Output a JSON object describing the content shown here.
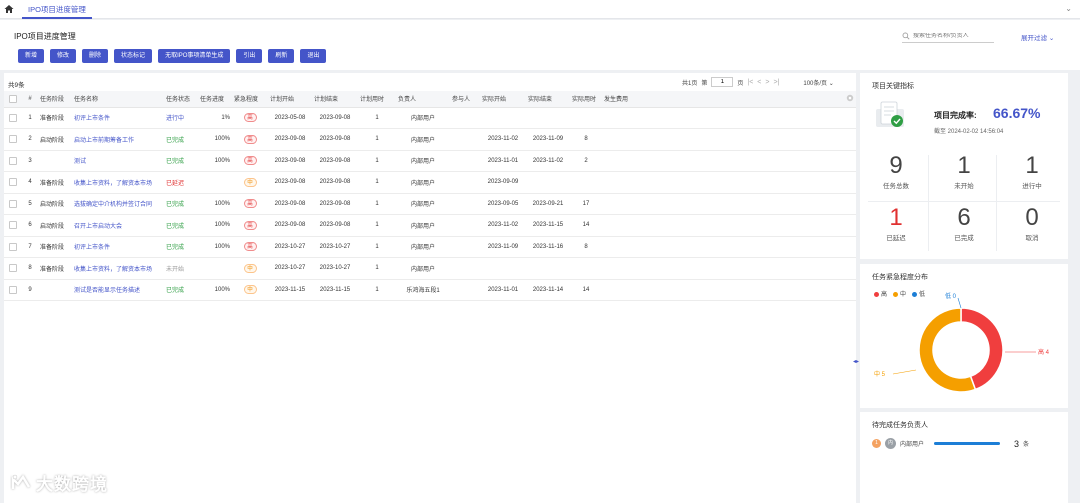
{
  "tabs": {
    "active": "IPO项目进度管理"
  },
  "header": {
    "title": "IPO项目进度管理",
    "buttons": [
      "新增",
      "修改",
      "删除",
      "状态标记",
      "无取IPO事项清单生成",
      "引出",
      "刷新",
      "退出"
    ],
    "search_placeholder": "搜索任务名称/负责人",
    "expand_filter": "展开过滤"
  },
  "table": {
    "total": "共9条",
    "pager": {
      "page_info": "共1页",
      "label_page": "第",
      "current": "1",
      "label_unit": "页",
      "page_size": "100条/页"
    },
    "columns": [
      "#",
      "任务阶段",
      "任务名称",
      "任务状态",
      "任务进度",
      "紧急程度",
      "计划开始",
      "计划结束",
      "计划用时",
      "负责人",
      "参与人",
      "实际开始",
      "实际结束",
      "实际用时",
      "发生费用"
    ],
    "rows": [
      {
        "no": "1",
        "stage": "准备阶段",
        "name": "初评上市条件",
        "status": "进行中",
        "status_type": "running",
        "progress": "1%",
        "urgency": "高",
        "urgency_type": "high",
        "plan_start": "2023-05-08",
        "plan_end": "2023-09-08",
        "plan_days": "1",
        "owner": "内部用户",
        "participant": "",
        "act_start": "",
        "act_end": "",
        "act_days": "",
        "cost": ""
      },
      {
        "no": "2",
        "stage": "启动阶段",
        "name": "启动上市前期筹备工作",
        "status": "已完成",
        "status_type": "done",
        "progress": "100%",
        "urgency": "高",
        "urgency_type": "high",
        "plan_start": "2023-09-08",
        "plan_end": "2023-09-08",
        "plan_days": "1",
        "owner": "内部用户",
        "participant": "",
        "act_start": "2023-11-02",
        "act_end": "2023-11-09",
        "act_days": "8",
        "cost": ""
      },
      {
        "no": "3",
        "stage": "",
        "name": "测试",
        "status": "已完成",
        "status_type": "done",
        "progress": "100%",
        "urgency": "高",
        "urgency_type": "high",
        "plan_start": "2023-09-08",
        "plan_end": "2023-09-08",
        "plan_days": "1",
        "owner": "内部用户",
        "participant": "",
        "act_start": "2023-11-01",
        "act_end": "2023-11-02",
        "act_days": "2",
        "cost": ""
      },
      {
        "no": "4",
        "stage": "准备阶段",
        "name": "收集上市资料，了解资本市场",
        "status": "已延迟",
        "status_type": "delay",
        "progress": "",
        "urgency": "中",
        "urgency_type": "mid",
        "plan_start": "2023-09-08",
        "plan_end": "2023-09-08",
        "plan_days": "1",
        "owner": "内部用户",
        "participant": "",
        "act_start": "2023-09-09",
        "act_end": "",
        "act_days": "",
        "cost": ""
      },
      {
        "no": "5",
        "stage": "启动阶段",
        "name": "选拔确定中介机构并签订合同",
        "status": "已完成",
        "status_type": "done",
        "progress": "100%",
        "urgency": "高",
        "urgency_type": "high",
        "plan_start": "2023-09-08",
        "plan_end": "2023-09-08",
        "plan_days": "1",
        "owner": "内部用户",
        "participant": "",
        "act_start": "2023-09-05",
        "act_end": "2023-09-21",
        "act_days": "17",
        "cost": ""
      },
      {
        "no": "6",
        "stage": "启动阶段",
        "name": "召开上市启动大会",
        "status": "已完成",
        "status_type": "done",
        "progress": "100%",
        "urgency": "高",
        "urgency_type": "high",
        "plan_start": "2023-09-08",
        "plan_end": "2023-09-08",
        "plan_days": "1",
        "owner": "内部用户",
        "participant": "",
        "act_start": "2023-11-02",
        "act_end": "2023-11-15",
        "act_days": "14",
        "cost": ""
      },
      {
        "no": "7",
        "stage": "准备阶段",
        "name": "初评上市条件",
        "status": "已完成",
        "status_type": "done",
        "progress": "100%",
        "urgency": "高",
        "urgency_type": "high",
        "plan_start": "2023-10-27",
        "plan_end": "2023-10-27",
        "plan_days": "1",
        "owner": "内部用户",
        "participant": "",
        "act_start": "2023-11-09",
        "act_end": "2023-11-16",
        "act_days": "8",
        "cost": ""
      },
      {
        "no": "8",
        "stage": "准备阶段",
        "name": "收集上市资料，了解资本市场",
        "status": "未开始",
        "status_type": "none",
        "progress": "",
        "urgency": "中",
        "urgency_type": "mid",
        "plan_start": "2023-10-27",
        "plan_end": "2023-10-27",
        "plan_days": "1",
        "owner": "内部用户",
        "participant": "",
        "act_start": "",
        "act_end": "",
        "act_days": "",
        "cost": ""
      },
      {
        "no": "9",
        "stage": "",
        "name": "测试是否能显示任务描述",
        "status": "已完成",
        "status_type": "done",
        "progress": "100%",
        "urgency": "中",
        "urgency_type": "mid",
        "plan_start": "2023-11-15",
        "plan_end": "2023-11-15",
        "plan_days": "1",
        "owner": "乐鸿海五段1",
        "participant": "",
        "act_start": "2023-11-01",
        "act_end": "2023-11-14",
        "act_days": "14",
        "cost": ""
      }
    ]
  },
  "kpi": {
    "title": "项目关键指标",
    "rate_label": "项目完成率:",
    "rate_value": "66.67%",
    "deadline": "截至 2024-02-02 14:56:04",
    "items": [
      {
        "value": "9",
        "label": "任务总数",
        "alert": false
      },
      {
        "value": "1",
        "label": "未开始",
        "alert": false
      },
      {
        "value": "1",
        "label": "进行中",
        "alert": false
      },
      {
        "value": "1",
        "label": "已延迟",
        "alert": true
      },
      {
        "value": "6",
        "label": "已完成",
        "alert": false
      },
      {
        "value": "0",
        "label": "取消",
        "alert": false
      }
    ]
  },
  "distribution": {
    "title": "任务紧急程度分布",
    "legend": [
      {
        "name": "高",
        "color": "#f03e3e"
      },
      {
        "name": "中",
        "color": "#f59f00"
      },
      {
        "name": "低",
        "color": "#1c7ed6"
      }
    ],
    "chart_data": {
      "type": "pie",
      "categories": [
        "高",
        "中",
        "低"
      ],
      "values": [
        4,
        5,
        0
      ],
      "labels": [
        "高 4",
        "中 5",
        "低 0"
      ]
    }
  },
  "owners": {
    "title": "待完成任务负责人",
    "rows": [
      {
        "rank": "1",
        "avatar": "内",
        "name": "内部用户",
        "count": "3",
        "unit": "条",
        "share": 1.0
      }
    ]
  },
  "logo": {
    "text": "大数跨境"
  }
}
